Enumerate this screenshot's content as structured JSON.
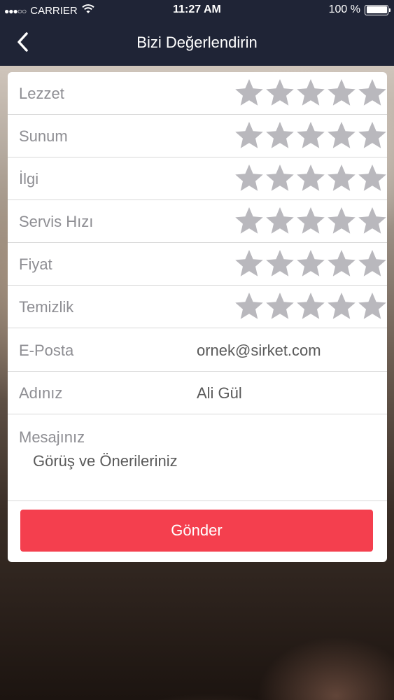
{
  "status_bar": {
    "signal": "●●●○○",
    "carrier": "CARRIER",
    "time": "11:27 AM",
    "battery_text": "100 %",
    "battery_level": 1.0
  },
  "nav": {
    "title": "Bizi Değerlendirin",
    "back_icon": "chevron-left-icon"
  },
  "ratings": [
    {
      "label": "Lezzet",
      "value": 0,
      "max": 5
    },
    {
      "label": "Sunum",
      "value": 0,
      "max": 5
    },
    {
      "label": "İlgi",
      "value": 0,
      "max": 5
    },
    {
      "label": "Servis Hızı",
      "value": 0,
      "max": 5
    },
    {
      "label": "Fiyat",
      "value": 0,
      "max": 5
    },
    {
      "label": "Temizlik",
      "value": 0,
      "max": 5
    }
  ],
  "form": {
    "email_label": "E-Posta",
    "email_placeholder": "ornek@sirket.com",
    "name_label": "Adınız",
    "name_placeholder": "Ali Gül",
    "message_label": "Mesajınız",
    "message_placeholder": "Görüş ve Önerileriniz"
  },
  "submit_label": "Gönder",
  "colors": {
    "nav_bg": "#1f2436",
    "star_empty": "#b9b8bd",
    "button": "#f43f4e"
  }
}
